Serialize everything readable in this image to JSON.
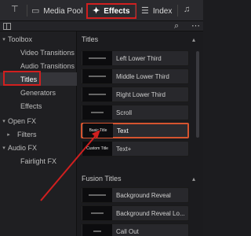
{
  "topbar": {
    "tabs": [
      {
        "label": "Media Pool",
        "icon": "media-pool-icon"
      },
      {
        "label": "Effects",
        "icon": "magic-wand-icon",
        "active": true
      },
      {
        "label": "Index",
        "icon": "index-list-icon"
      }
    ]
  },
  "toolbar": {
    "search_icon": "search-icon",
    "more_icon": "more-options-icon"
  },
  "sidebar": {
    "items": [
      {
        "label": "Toolbox",
        "expanded": true
      },
      {
        "label": "Video Transitions"
      },
      {
        "label": "Audio Transitions"
      },
      {
        "label": "Titles",
        "selected": true
      },
      {
        "label": "Generators"
      },
      {
        "label": "Effects"
      },
      {
        "label": "Open FX",
        "expanded": true
      },
      {
        "label": "Filters",
        "collapsed": true
      },
      {
        "label": "Audio FX",
        "expanded": true
      },
      {
        "label": "Fairlight FX"
      }
    ]
  },
  "titles_section": {
    "header": "Titles",
    "items": [
      {
        "name": "Left Lower Third",
        "thumb": ""
      },
      {
        "name": "Middle Lower Third",
        "thumb": ""
      },
      {
        "name": "Right Lower Third",
        "thumb": ""
      },
      {
        "name": "Scroll",
        "thumb": ""
      },
      {
        "name": "Text",
        "thumb": "Basic Title",
        "selected": true
      },
      {
        "name": "Text+",
        "thumb": "Custom Title"
      }
    ]
  },
  "fusion_section": {
    "header": "Fusion Titles",
    "items": [
      {
        "name": "Background Reveal"
      },
      {
        "name": "Background Reveal Lo..."
      },
      {
        "name": "Call Out"
      }
    ]
  },
  "colors": {
    "highlight": "#d11f1f",
    "selected_border": "#d5542f"
  }
}
